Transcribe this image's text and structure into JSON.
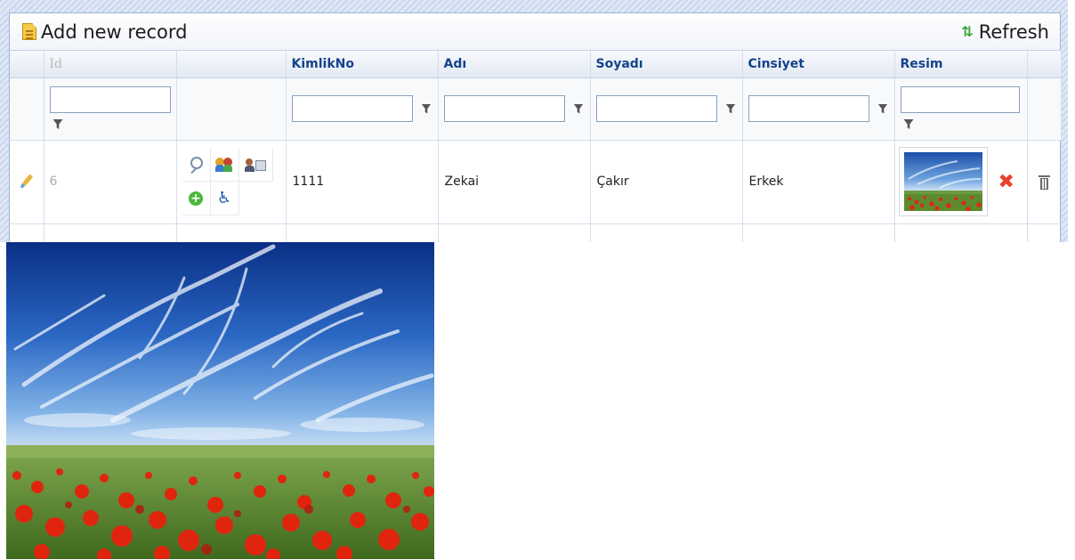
{
  "toolbar": {
    "add_label": "Add new record",
    "refresh_label": "Refresh"
  },
  "columns": {
    "id": "Id",
    "kimlikno": "KimlikNo",
    "adi": "Adı",
    "soyadi": "Soyadı",
    "cinsiyet": "Cinsiyet",
    "resim": "Resim"
  },
  "row": {
    "id": "6",
    "kimlikno": "1111",
    "adi": "Zekai",
    "soyadi": "Çakır",
    "cinsiyet": "Erkek"
  },
  "colors": {
    "header_text": "#15428b",
    "accent_border": "#9fb4d6",
    "delete_red": "#e8412b",
    "add_green": "#4cb83a"
  },
  "icons": [
    "document-icon",
    "refresh-icon",
    "funnel-icon",
    "pencil-icon",
    "magnify-icon",
    "users-icon",
    "user-card-icon",
    "add-icon",
    "wheelchair-icon",
    "delete-x-icon",
    "trash-icon"
  ]
}
